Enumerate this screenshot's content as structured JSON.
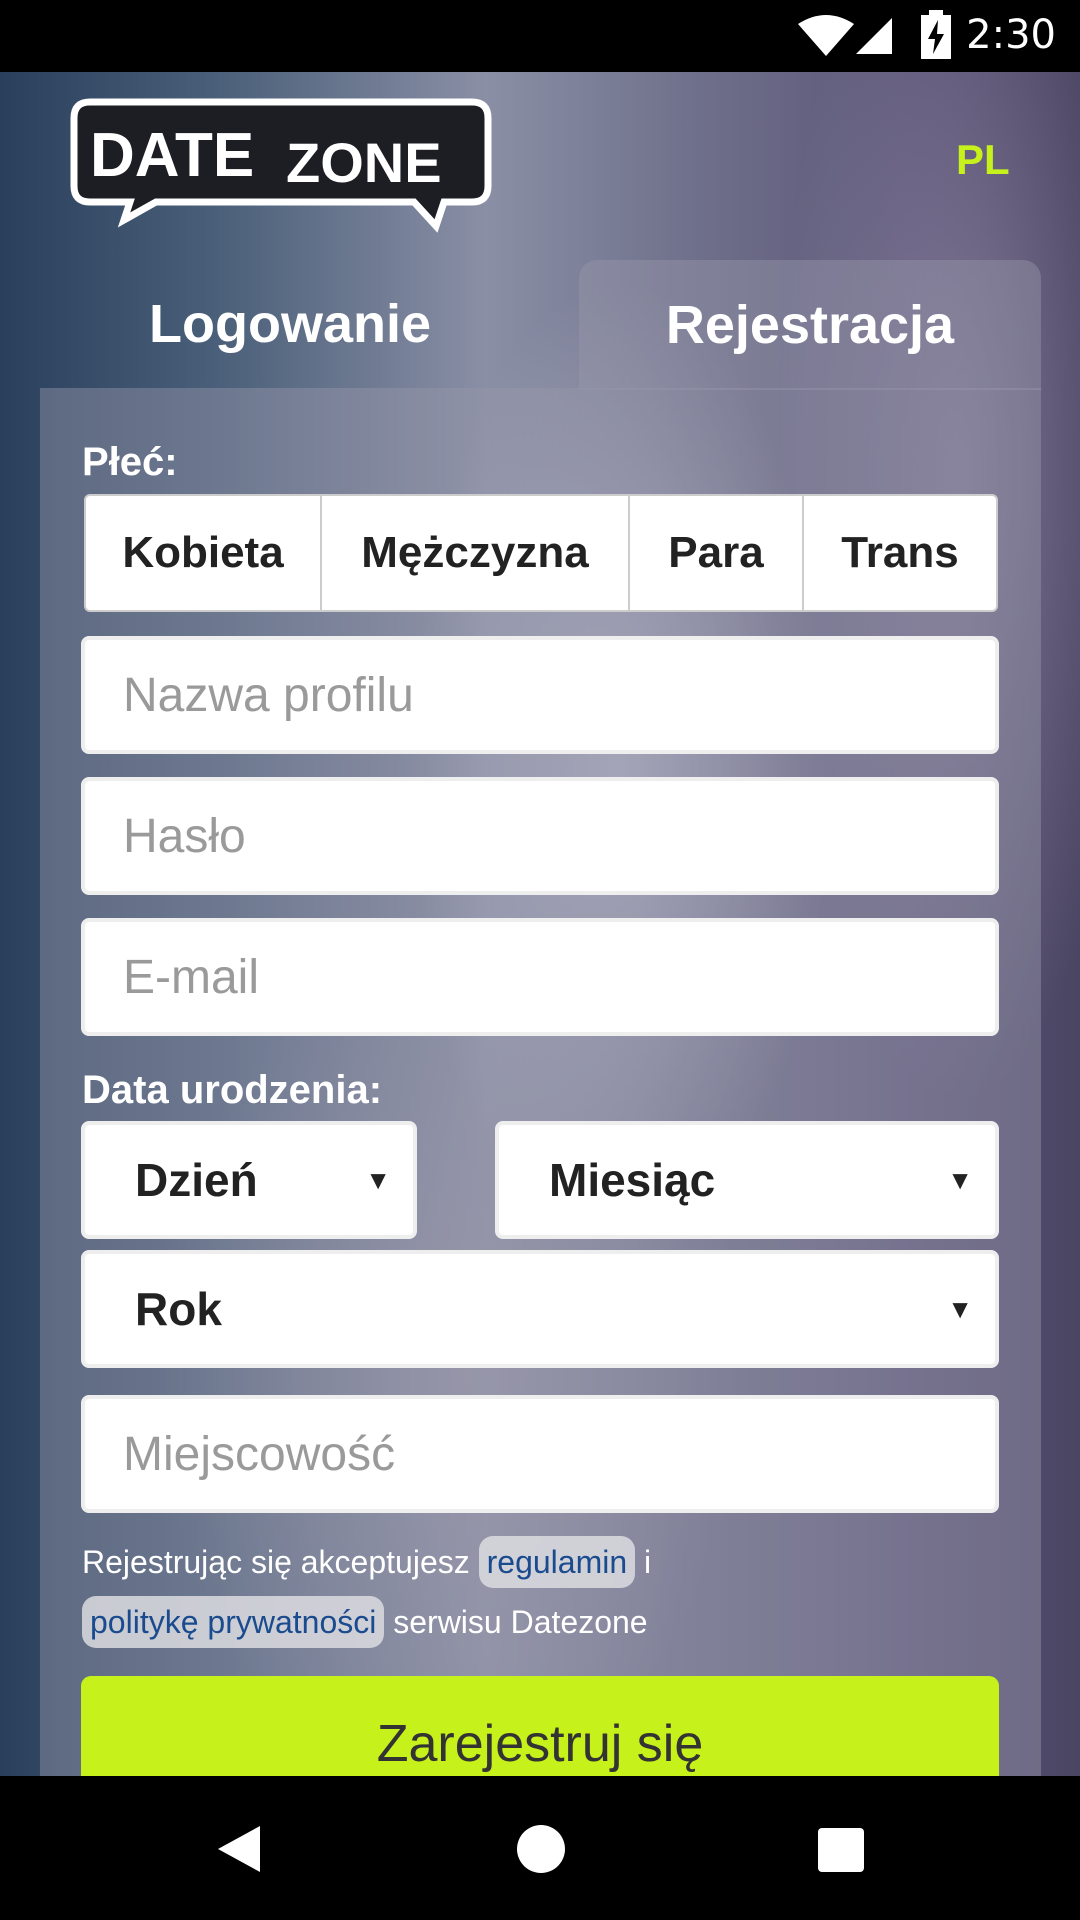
{
  "status_bar": {
    "time": "2:30"
  },
  "header": {
    "logo_alt": "DATE ZONE",
    "logo_word1": "DATE",
    "logo_word2": "ZONE",
    "language": "PL"
  },
  "tabs": [
    {
      "label": "Logowanie",
      "active": false
    },
    {
      "label": "Rejestracja",
      "active": true
    }
  ],
  "form": {
    "gender_label": "Płeć:",
    "gender_options": [
      "Kobieta",
      "Mężczyzna",
      "Para",
      "Trans"
    ],
    "profile_name_placeholder": "Nazwa profilu",
    "password_placeholder": "Hasło",
    "email_placeholder": "E-mail",
    "birthdate_label": "Data urodzenia:",
    "day_select": "Dzień",
    "month_select": "Miesiąc",
    "year_select": "Rok",
    "city_placeholder": "Miejscowość",
    "terms_prefix": "Rejestrując się akceptujesz",
    "terms_link": "regulamin",
    "terms_join": "i",
    "privacy_link": "politykę prywatności",
    "terms_suffix": "serwisu Datezone",
    "submit_label": "Zarejestruj się"
  },
  "colors": {
    "accent": "#c6f11a",
    "link": "#1a4b8e"
  },
  "icons": [
    "wifi-icon",
    "cell-signal-icon",
    "battery-charging-icon",
    "back-icon",
    "home-icon",
    "recents-icon"
  ]
}
